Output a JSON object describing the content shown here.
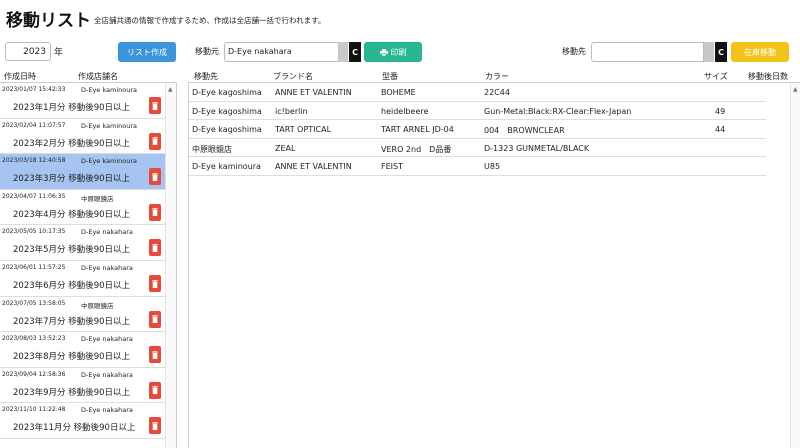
{
  "header": {
    "title": "移動リスト",
    "description": "全店舗共通の情報で作成するため、作成は全店舗一括で行われます。"
  },
  "toolbar": {
    "year_value": "2023",
    "year_label": "年",
    "create_button": "リスト作成",
    "from_label": "移動元",
    "from_value": "D-Eye nakahara",
    "clear_label": "C",
    "print_button": "印刷",
    "to_label": "移動先",
    "to_value": "",
    "stock_move_button": "在庫移動"
  },
  "left_table": {
    "columns": [
      "作成日時",
      "作成店舗名"
    ],
    "items": [
      {
        "datetime": "2023/01/07 15:42:33",
        "store": "D-Eye kaminoura",
        "name": "2023年1月分 移動後90日以上",
        "selected": false
      },
      {
        "datetime": "2023/02/04 11:07:57",
        "store": "D-Eye kaminoura",
        "name": "2023年2月分 移動後90日以上",
        "selected": false
      },
      {
        "datetime": "2023/03/18 12:40:58",
        "store": "D-Eye kaminoura",
        "name": "2023年3月分 移動後90日以上",
        "selected": true
      },
      {
        "datetime": "2023/04/07 11:06:35",
        "store": "中原眼鏡店",
        "name": "2023年4月分 移動後90日以上",
        "selected": false
      },
      {
        "datetime": "2023/05/05 10:17:35",
        "store": "D-Eye nakahara",
        "name": "2023年5月分 移動後90日以上",
        "selected": false
      },
      {
        "datetime": "2023/06/01 11:57:25",
        "store": "D-Eye nakahara",
        "name": "2023年6月分 移動後90日以上",
        "selected": false
      },
      {
        "datetime": "2023/07/05 13:58:05",
        "store": "中原眼鏡店",
        "name": "2023年7月分 移動後90日以上",
        "selected": false
      },
      {
        "datetime": "2023/08/03 13:52:23",
        "store": "D-Eye nakahara",
        "name": "2023年8月分 移動後90日以上",
        "selected": false
      },
      {
        "datetime": "2023/09/04 12:58:36",
        "store": "D-Eye nakahara",
        "name": "2023年9月分 移動後90日以上",
        "selected": false
      },
      {
        "datetime": "2023/11/10 11:22:48",
        "store": "D-Eye nakahara",
        "name": "2023年11月分 移動後90日以上",
        "selected": false
      }
    ]
  },
  "right_table": {
    "columns": [
      "移動先",
      "ブランド名",
      "型番",
      "カラー",
      "サイズ",
      "移動後日数"
    ],
    "rows": [
      {
        "dest": "D-Eye kagoshima",
        "brand": "ANNE ET VALENTIN",
        "model": "BOHEME",
        "color": "22C44",
        "size": "",
        "days": ""
      },
      {
        "dest": "D-Eye kagoshima",
        "brand": "ic!berlin",
        "model": "heidelbeere",
        "color": "Gun-Metal:Black:RX-Clear:Flex-Japan",
        "size": "49",
        "days": ""
      },
      {
        "dest": "D-Eye kagoshima",
        "brand": "TART OPTICAL",
        "model": "TART ARNEL JD-04",
        "color": "004　BROWNCLEAR",
        "size": "44",
        "days": ""
      },
      {
        "dest": "中原眼鏡店",
        "brand": "ZEAL",
        "model": "VERO 2nd　D品番",
        "color": "D-1323 GUNMETAL/BLACK",
        "size": "",
        "days": ""
      },
      {
        "dest": "D-Eye kaminoura",
        "brand": "ANNE ET VALENTIN",
        "model": "FEIST",
        "color": "U85",
        "size": "",
        "days": ""
      }
    ]
  },
  "colors": {
    "create_button": "#3a95dc",
    "print_button": "#27b790",
    "stock_button": "#f2c419",
    "selected_row": "#a5c4f1",
    "delete_button": "#e74a3b"
  }
}
